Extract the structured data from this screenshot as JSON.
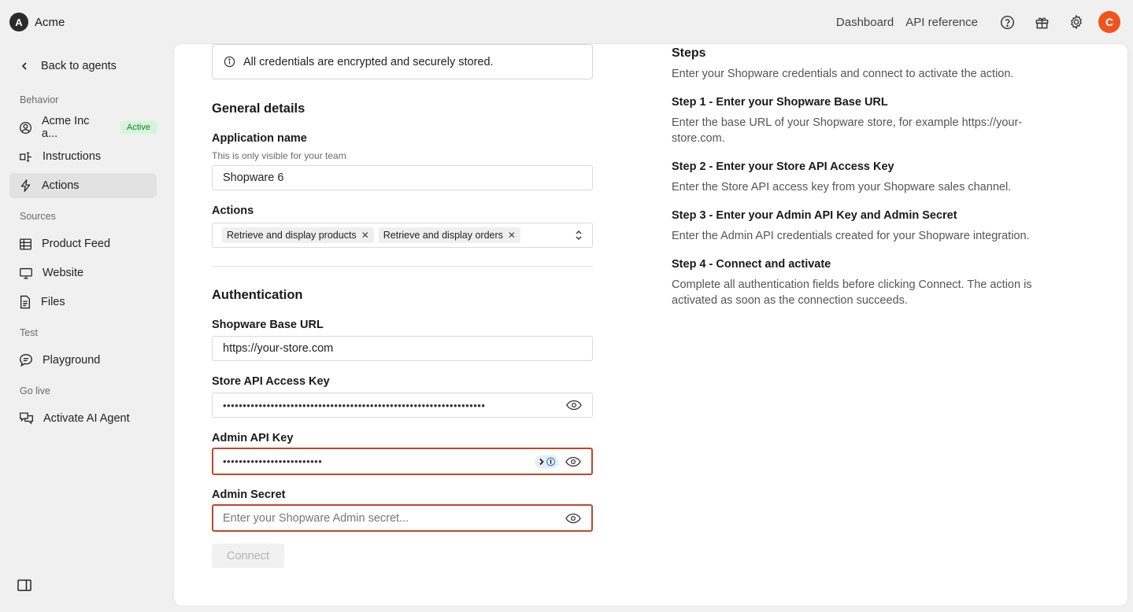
{
  "app": {
    "logo_letter": "A",
    "name": "Acme"
  },
  "topnav": {
    "dashboard": "Dashboard",
    "api_reference": "API reference",
    "avatar_letter": "C",
    "accent_color": "#f0541e"
  },
  "sidebar": {
    "back": "Back to agents",
    "sections": {
      "behavior": "Behavior",
      "sources": "Sources",
      "test": "Test",
      "go_live": "Go live"
    },
    "items": {
      "agent": {
        "label": "Acme Inc a...",
        "badge": "Active"
      },
      "instructions": "Instructions",
      "actions": "Actions",
      "product_feed": "Product Feed",
      "website": "Website",
      "files": "Files",
      "playground": "Playground",
      "activate": "Activate AI Agent"
    }
  },
  "form": {
    "notice": "All credentials are encrypted and securely stored.",
    "general_heading": "General details",
    "app_name_label": "Application name",
    "app_name_hint": "This is only visible for your team",
    "app_name_value": "Shopware 6",
    "actions_label": "Actions",
    "actions_selected": [
      "Retrieve and display products",
      "Retrieve and display orders"
    ],
    "auth_heading": "Authentication",
    "base_url_label": "Shopware Base URL",
    "base_url_value": "https://your-store.com",
    "store_key_label": "Store API Access Key",
    "store_key_masked": "••••••••••••••••••••••••••••••••••••••••••••••••••••••••••••••••••",
    "admin_key_label": "Admin API Key",
    "admin_key_masked": "•••••••••••••••••••••••••",
    "admin_secret_label": "Admin Secret",
    "admin_secret_placeholder": "Enter your Shopware Admin secret...",
    "connect_button": "Connect",
    "error_color": "#c2452d"
  },
  "steps": {
    "title": "Steps",
    "intro": "Enter your Shopware credentials and connect to activate the action.",
    "step1_title": "Step 1 - Enter your Shopware Base URL",
    "step1_text": "Enter the base URL of your Shopware store, for example https://your-store.com.",
    "step2_title": "Step 2 - Enter your Store API Access Key",
    "step2_text": "Enter the Store API access key from your Shopware sales channel.",
    "step3_title": "Step 3 - Enter your Admin API Key and Admin Secret",
    "step3_text": "Enter the Admin API credentials created for your Shopware integration.",
    "step4_title": "Step 4 - Connect and activate",
    "step4_text": "Complete all authentication fields before clicking Connect. The action is activated as soon as the connection succeeds."
  }
}
